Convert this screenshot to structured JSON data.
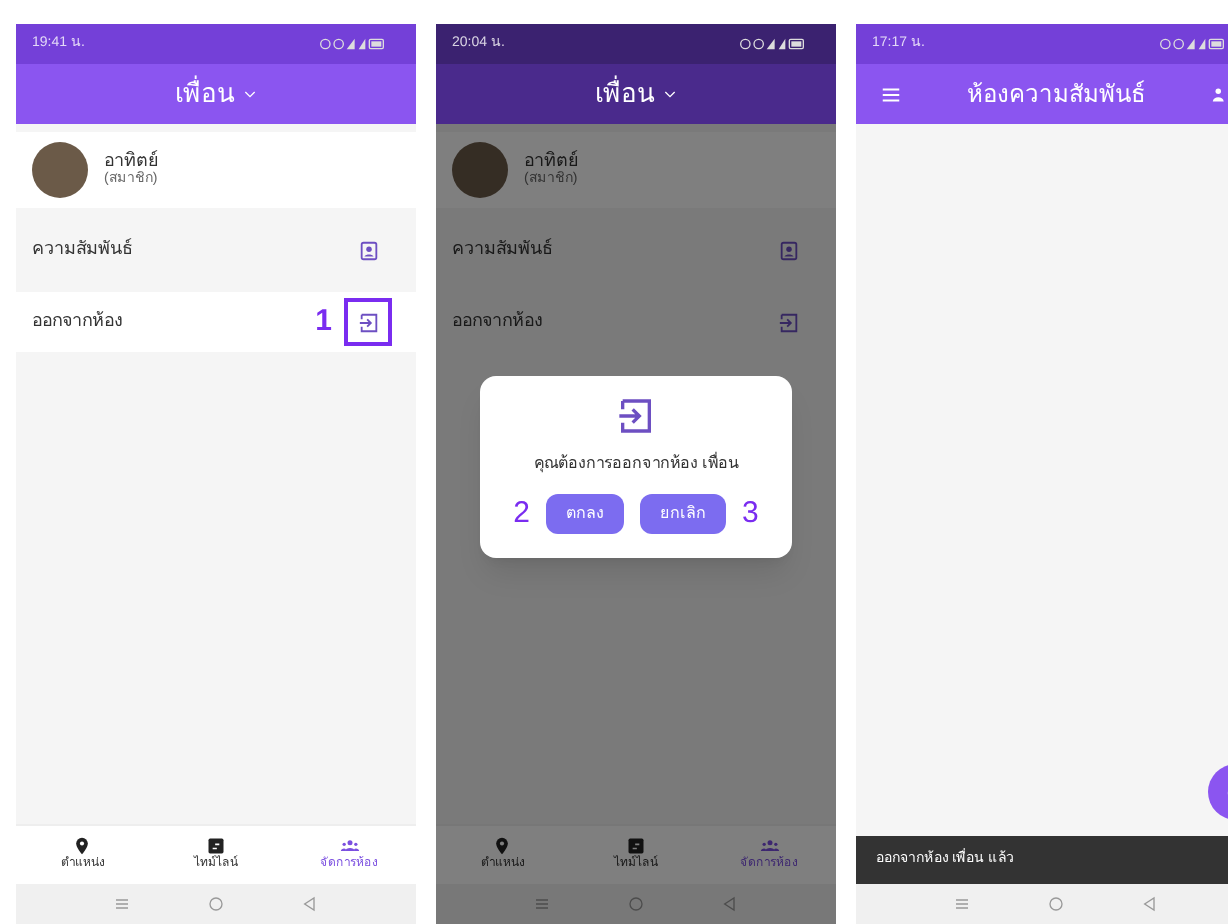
{
  "screens": [
    {
      "kind": "room",
      "status_time": "19:41 น.",
      "title": "เพื่อน",
      "dimmed": false,
      "member": {
        "name": "อาทิตย์",
        "role": "(สมาชิก)"
      },
      "rows": [
        {
          "label": "ความสัมพันธ์"
        },
        {
          "label": "ออกจากห้อง",
          "callout": "1"
        }
      ],
      "nav": [
        {
          "label": "ตำแหน่ง",
          "selected": false
        },
        {
          "label": "ไทม์ไลน์",
          "selected": false
        },
        {
          "label": "จัดการห้อง",
          "selected": true
        }
      ]
    },
    {
      "kind": "room",
      "status_time": "20:04 น.",
      "title": "เพื่อน",
      "dimmed": true,
      "member": {
        "name": "อาทิตย์",
        "role": "(สมาชิก)"
      },
      "rows": [
        {
          "label": "ความสัมพันธ์"
        },
        {
          "label": "ออกจากห้อง"
        }
      ],
      "nav": [
        {
          "label": "ตำแหน่ง",
          "selected": false
        },
        {
          "label": "ไทม์ไลน์",
          "selected": false
        },
        {
          "label": "จัดการห้อง",
          "selected": true
        }
      ],
      "dialog": {
        "message": "คุณต้องการออกจากห้อง เพื่อน",
        "buttons": [
          {
            "label": "ตกลง",
            "callout": "2"
          },
          {
            "label": "ยกเลิก",
            "callout": "3"
          }
        ]
      }
    },
    {
      "kind": "list",
      "status_time": "17:17 น.",
      "title": "ห้องความสัมพันธ์",
      "snackbar": "ออกจากห้อง เพื่อน แล้ว"
    }
  ]
}
